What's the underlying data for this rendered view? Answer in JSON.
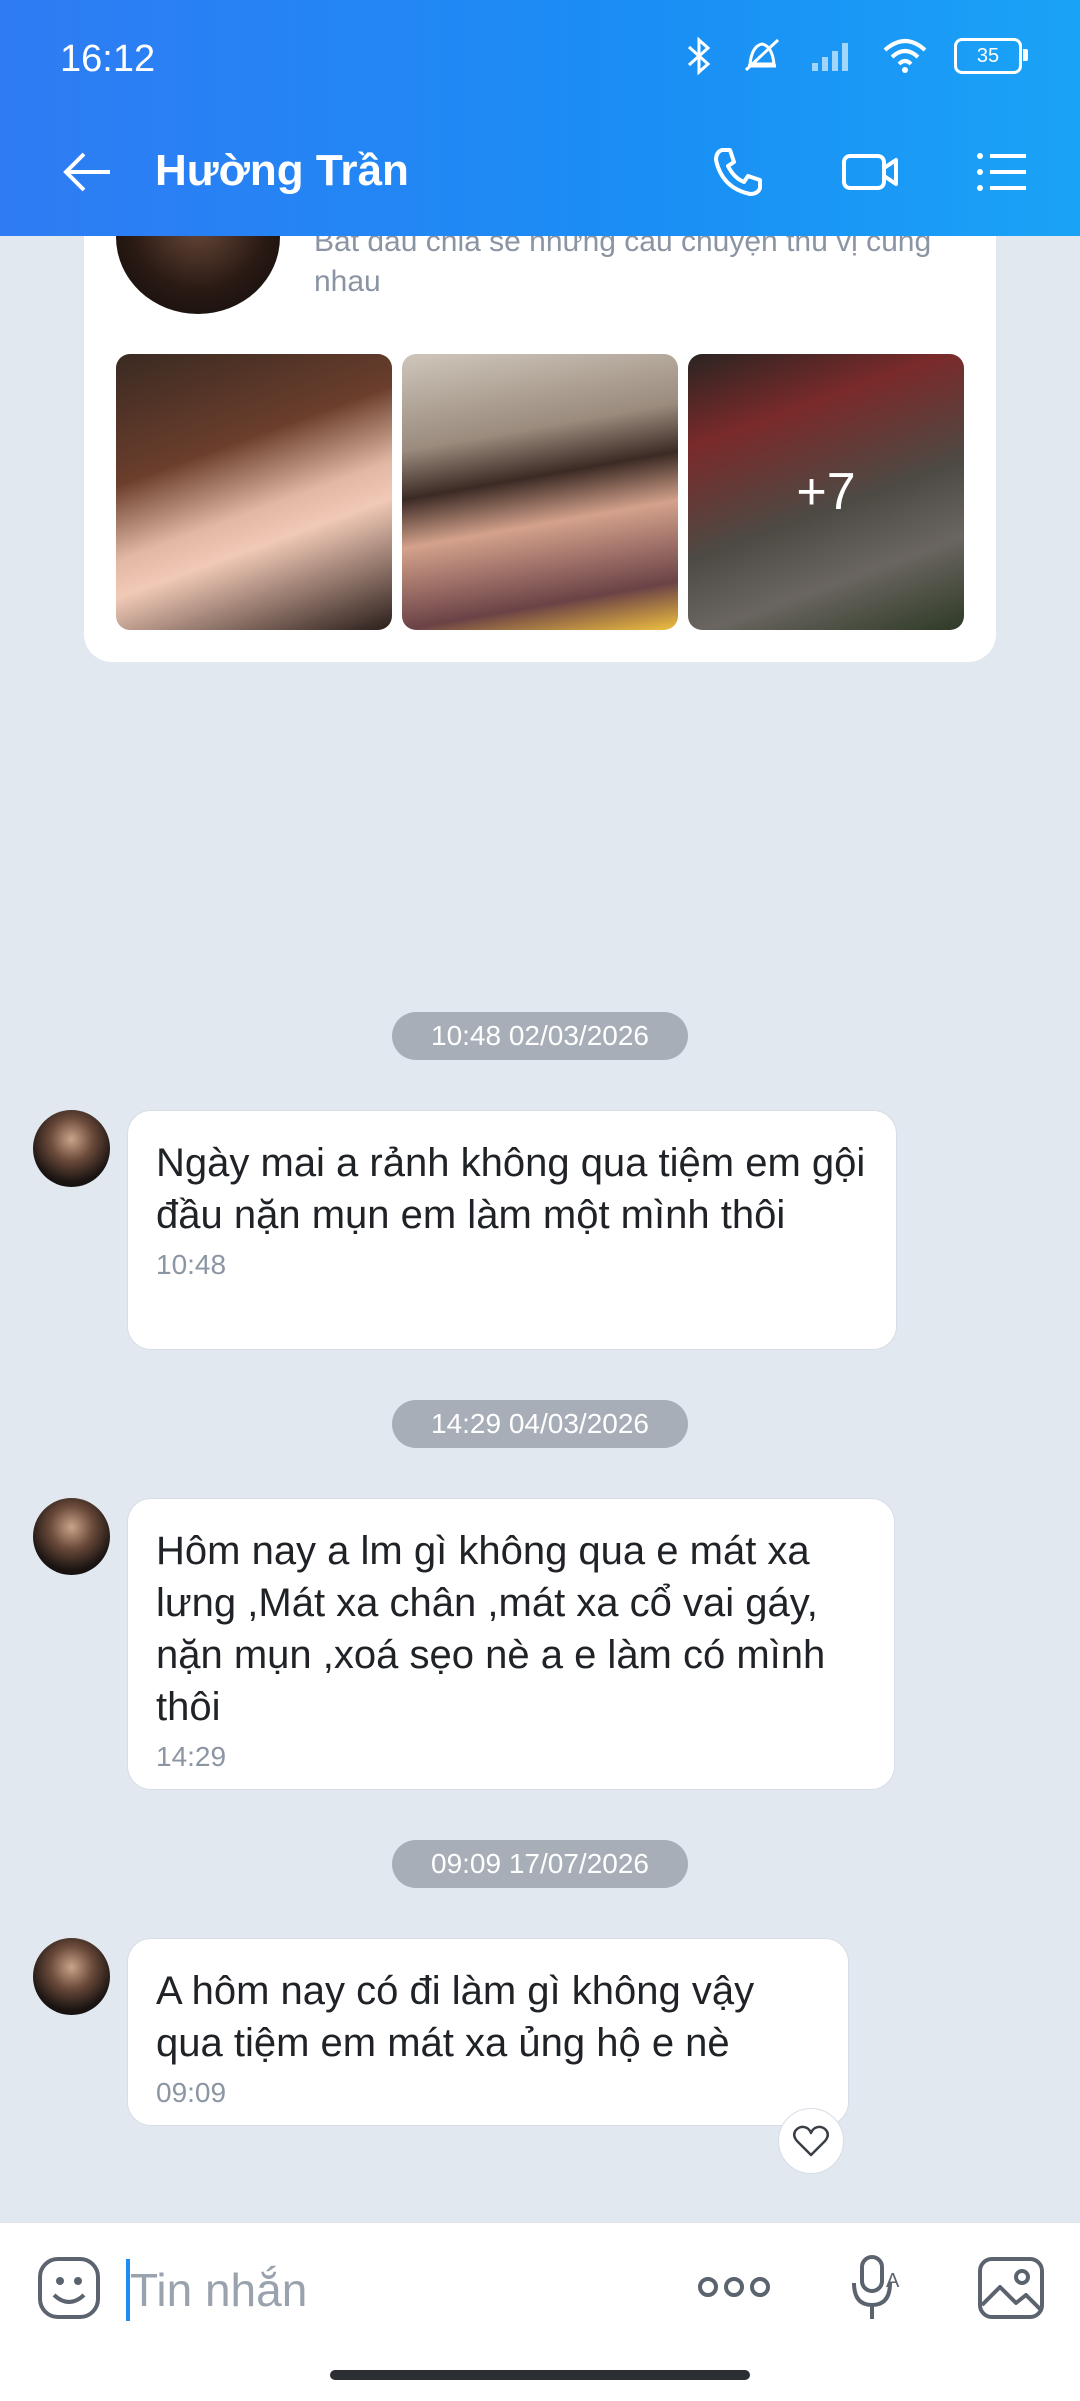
{
  "status_bar": {
    "time": "16:12",
    "battery": "35"
  },
  "header": {
    "title": "Hường Trần"
  },
  "profile_card": {
    "subtitle": "Bắt đầu chia sẻ những câu chuyện thú vị cùng nhau",
    "more_photos": "+7"
  },
  "messages": [
    {
      "date": "10:48 02/03/2026",
      "text": "Ngày mai a rảnh không qua tiệm em gội đầu nặn mụn em làm một mình thôi",
      "time": "10:48"
    },
    {
      "date": "14:29 04/03/2026",
      "text": "Hôm nay a lm gì không qua e mát xa lưng ,Mát xa chân ,mát xa cổ vai gáy, nặn mụn ,xoá sẹo nè a e làm có mình thôi",
      "time": "14:29"
    },
    {
      "date": "09:09 17/07/2026",
      "text": "A hôm nay có đi làm gì không vậy qua tiệm em mát xa ủng hộ e nè",
      "time": "09:09"
    }
  ],
  "composer": {
    "placeholder": "Tin nhắn"
  },
  "colors": {
    "header_blue": "#1a8ef5",
    "background": "#e2e8f0",
    "date_pill": "#a7aeb8"
  }
}
